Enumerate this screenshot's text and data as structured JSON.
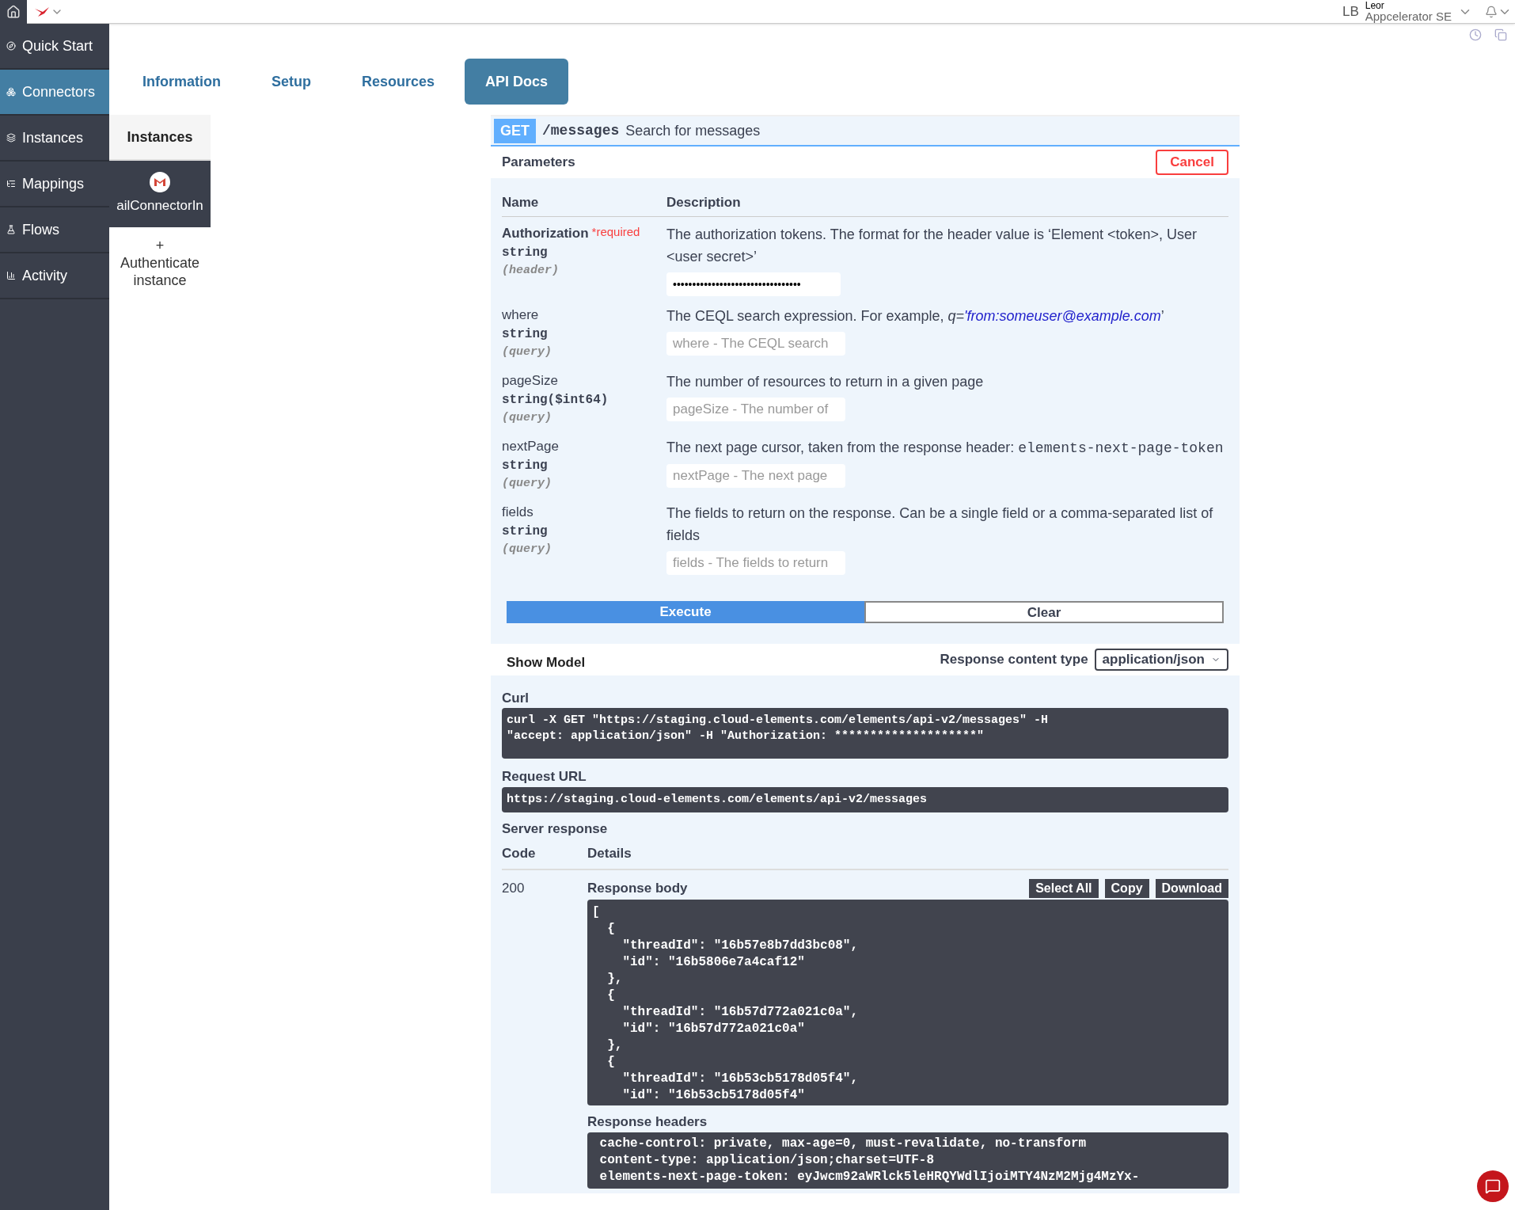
{
  "top_bar": {
    "initials": "LB",
    "user_name": "Leor",
    "org_name": "Appcelerator SE"
  },
  "sidebar": {
    "items": [
      {
        "label": "Quick Start",
        "selected": false
      },
      {
        "label": "Connectors",
        "selected": true
      },
      {
        "label": "Instances",
        "selected": false
      },
      {
        "label": "Mappings",
        "selected": false
      },
      {
        "label": "Flows",
        "selected": false
      },
      {
        "label": "Activity",
        "selected": false
      }
    ]
  },
  "instances_panel": {
    "title": "Instances",
    "instance_name": "ailConnectorIn",
    "add_symbol": "+",
    "add_label": "Authenticate instance"
  },
  "tabs": [
    {
      "label": "Information",
      "selected": false
    },
    {
      "label": "Setup",
      "selected": false
    },
    {
      "label": "Resources",
      "selected": false
    },
    {
      "label": "API Docs",
      "selected": true
    }
  ],
  "operation": {
    "method": "GET",
    "path": "/messages",
    "summary": "Search for messages"
  },
  "parameters": {
    "title": "Parameters",
    "cancel": "Cancel",
    "name_heading": "Name",
    "description_heading": "Description",
    "rows": [
      {
        "name": "Authorization",
        "required": true,
        "required_label": "*required",
        "type": "string",
        "location": "(header)",
        "description": "The authorization tokens. The format for the header value is ‘Element <token>, User <user secret>’",
        "value": "•••••••••••••••••••••••••••••••••"
      },
      {
        "name": "where",
        "required": false,
        "type": "string",
        "location": "(query)",
        "description": "The CEQL search expression. For example, ",
        "example_prefix": "q=",
        "example_link": "'from:someuser@example.com",
        "example_suffix": "’",
        "placeholder": "where - The CEQL search"
      },
      {
        "name": "pageSize",
        "required": false,
        "type": "string($int64)",
        "location": "(query)",
        "description": "The number of resources to return in a given page",
        "placeholder": "pageSize - The number of"
      },
      {
        "name": "nextPage",
        "required": false,
        "type": "string",
        "location": "(query)",
        "description": "The next page cursor, taken from the response header: ",
        "code": "elements-next-page-token",
        "placeholder": "nextPage - The next page"
      },
      {
        "name": "fields",
        "required": false,
        "type": "string",
        "location": "(query)",
        "description": "The fields to return on the response. Can be a single field or a comma-separated list of fields",
        "placeholder": "fields - The fields to return"
      }
    ]
  },
  "actions": {
    "execute": "Execute",
    "clear": "Clear"
  },
  "model_bar": {
    "show_model": "Show Model",
    "content_type_label": "Response content type",
    "content_type": "application/json"
  },
  "curl": {
    "title": "Curl",
    "command": "curl -X GET \"https://staging.cloud-elements.com/elements/api-v2/messages\" -H\n\"accept: application/json\" -H \"Authorization: ********************\""
  },
  "request_url": {
    "title": "Request URL",
    "url": "https://staging.cloud-elements.com/elements/api-v2/messages"
  },
  "server_response": {
    "title": "Server response",
    "code_heading": "Code",
    "details_heading": "Details",
    "code": "200",
    "body_title": "Response body",
    "buttons": [
      "Select All",
      "Copy",
      "Download"
    ],
    "body": "[\n  {\n    \"threadId\": \"16b57e8b7dd3bc08\",\n    \"id\": \"16b5806e7a4caf12\"\n  },\n  {\n    \"threadId\": \"16b57d772a021c0a\",\n    \"id\": \"16b57d772a021c0a\"\n  },\n  {\n    \"threadId\": \"16b53cb5178d05f4\",\n    \"id\": \"16b53cb5178d05f4\"",
    "headers_title": "Response headers",
    "headers": " cache-control: private, max-age=0, must-revalidate, no-transform\n content-type: application/json;charset=UTF-8\n elements-next-page-token: eyJwcm92aWRlck5leHRQYWdlIjoiMTY4NzM2Mjg4MzYx-"
  }
}
